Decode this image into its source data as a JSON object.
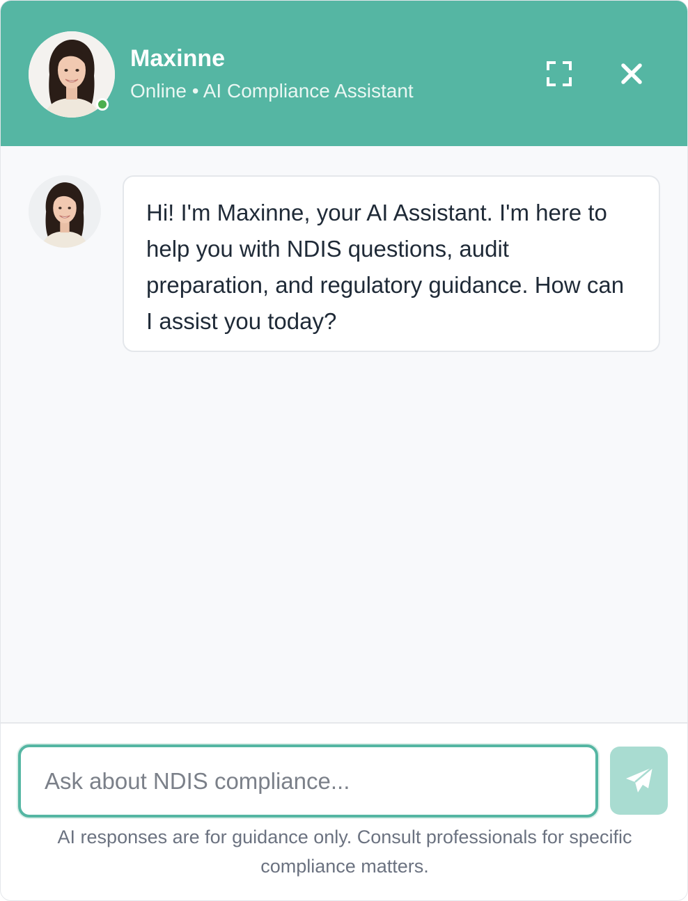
{
  "header": {
    "name": "Maxinne",
    "status": "Online • AI Compliance Assistant",
    "avatar_icon": "female-assistant-avatar",
    "expand_icon": "expand-icon",
    "close_icon": "close-icon",
    "background_color": "#55b6a3"
  },
  "messages": [
    {
      "sender": "assistant",
      "avatar_icon": "female-assistant-avatar",
      "text": "Hi! I'm Maxinne, your AI Assistant. I'm here to help you with NDIS questions, audit preparation, and regulatory guidance. How can I assist you today?"
    }
  ],
  "composer": {
    "placeholder": "Ask about NDIS compliance...",
    "value": "",
    "send_icon": "paper-plane-icon",
    "accent_color": "#55b6a3",
    "send_button_color": "#a9dcd1"
  },
  "disclaimer": "AI responses are for guidance only. Consult professionals for specific compliance matters."
}
